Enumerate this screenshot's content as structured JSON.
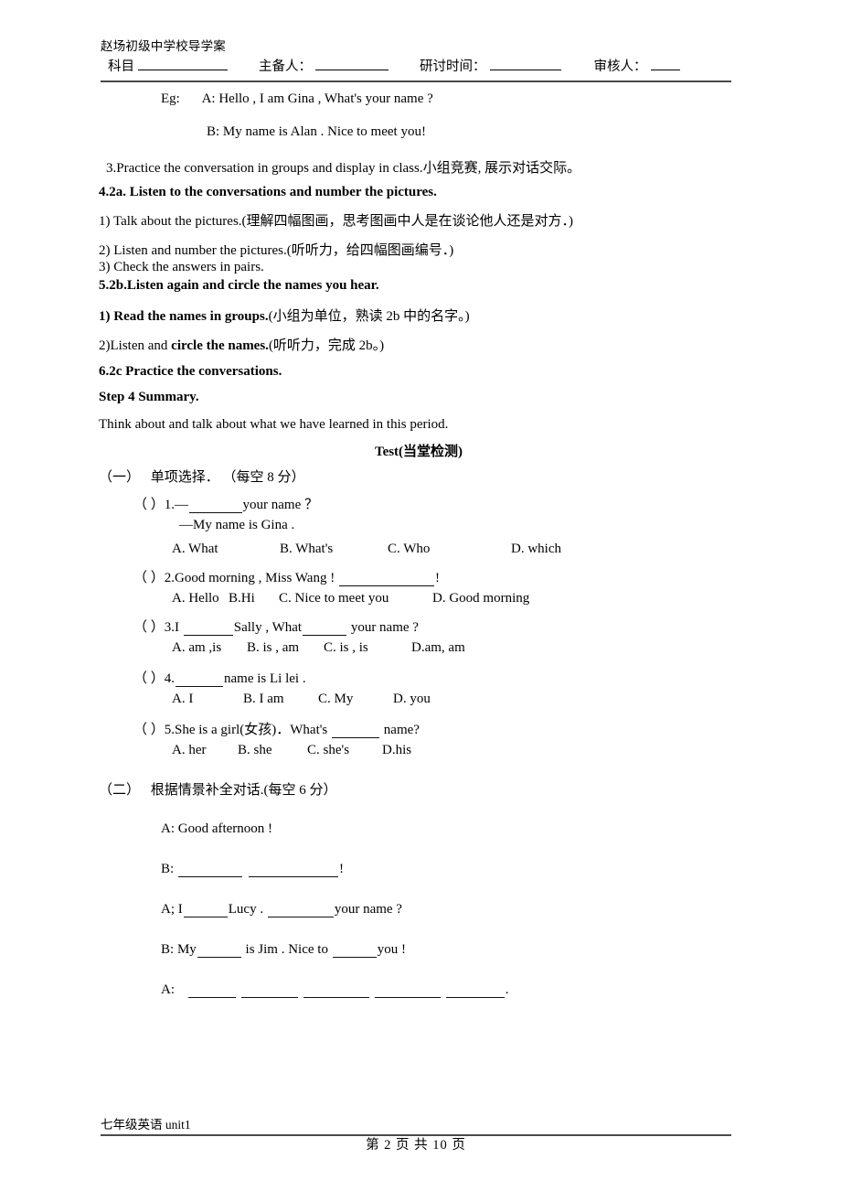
{
  "header": {
    "school_title": "赵场初级中学校导学案",
    "fields": [
      {
        "label": "科目",
        "separator": ""
      },
      {
        "label": "主备人：",
        "separator": ""
      },
      {
        "label": "研讨时间：",
        "separator": ""
      },
      {
        "label": "审核人：",
        "separator": ""
      }
    ]
  },
  "body": {
    "eg_label": "Eg:",
    "eg_line_a": "A: Hello , I am Gina , What's your name ?",
    "eg_line_b": "B: My name is Alan . Nice to meet you!",
    "item3": "3.Practice the conversation in groups and display in class.小组竞赛, 展示对话交际。",
    "item4_heading": "4.2a. Listen to the conversations and number the pictures.",
    "item4_1": "1) Talk about the pictures.(理解四幅图画，思考图画中人是在谈论他人还是对方．)",
    "item4_2": "2) Listen and number the pictures.(听听力，给四幅图画编号．)",
    "item4_3": "3) Check the answers in pairs.",
    "item5_heading": "5.2b.Listen again and circle the names you hear.",
    "item5_1_bold": "1) Read the names in groups.",
    "item5_1_rest": "(小组为单位，熟读 2b 中的名字。)",
    "item5_2_pre": "2)Listen and ",
    "item5_2_bold": "circle the names.",
    "item5_2_rest": "(听听力，完成 2b。)",
    "item6_heading": "6.2c Practice the conversations.",
    "step4_heading": "Step 4 Summary.",
    "step4_text": "Think about and talk about what we have learned in this period.",
    "test_heading": "Test(当堂检测)"
  },
  "section_one": {
    "label": "（一）",
    "title": "单项选择．",
    "score": "（每空 8 分）",
    "questions": [
      {
        "bracket": "（    ）",
        "number": "1.",
        "stem_pre": "—",
        "stem_post": "your name ？",
        "answer_line": "—My name is Gina .",
        "options": [
          "A. What",
          "B. What's",
          "C. Who",
          "D. which"
        ]
      },
      {
        "bracket": "（    ）",
        "number": "2.",
        "stem_pre": "Good morning , Miss Wang ! ",
        "stem_post": "!",
        "options": [
          "A. Hello",
          "B.Hi",
          "C. Nice to meet you",
          "D. Good morning"
        ]
      },
      {
        "bracket": "（    ）",
        "number": "3.",
        "stem_pre": "I ",
        "stem_mid": "Sally , What",
        "stem_post": " your name ?",
        "options": [
          "A. am ,is",
          "B. is , am",
          "C. is , is",
          "D.am, am"
        ]
      },
      {
        "bracket": "（    ）",
        "number": "4.",
        "stem_pre": " ",
        "stem_post": "name is Li lei .",
        "options": [
          "A. I",
          "B. I am",
          "C. My",
          "D. you"
        ]
      },
      {
        "bracket": "（    ）",
        "number": "5.",
        "stem_pre": "She is a girl(女孩)．What's ",
        "stem_post": " name?",
        "options": [
          "A. her",
          "B. she",
          "C. she's",
          "D.his"
        ]
      }
    ]
  },
  "section_two": {
    "label": "（二）",
    "title": "根据情景补全对话.",
    "score": "(每空 6 分）",
    "dialogue": [
      {
        "speaker": "A: ",
        "text": "Good afternoon !"
      },
      {
        "speaker": "B: ",
        "text": "!"
      },
      {
        "speaker": "A; ",
        "text": "I"
      },
      {
        "speaker": "B: ",
        "text": "My"
      },
      {
        "speaker": "A: ",
        "text": "."
      }
    ],
    "line_a2_mid": "Lucy . ",
    "line_a2_end": "your name ?",
    "line_b2_mid": " is Jim . Nice to ",
    "line_b2_end": "you !"
  },
  "footer": {
    "doc_label": "七年级英语 unit1",
    "page_text": "第 2 页 共 10 页"
  }
}
